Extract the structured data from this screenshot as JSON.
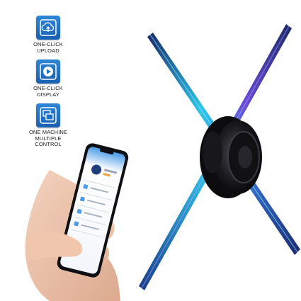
{
  "features": [
    {
      "icon": "cloud-upload-icon",
      "label": "ONE-CLICK\nUPLOAD"
    },
    {
      "icon": "play-icon",
      "label": "ONE-CLICK\nDISPLAY"
    },
    {
      "icon": "multi-screen-icon",
      "label": "ONE MACHINE\nMULTIPLE\nCONTROL"
    }
  ],
  "colors": {
    "icon_blue": "#1f6fc4",
    "blade_cyan": "#2fc6e8",
    "blade_purple": "#6a4bd6"
  }
}
